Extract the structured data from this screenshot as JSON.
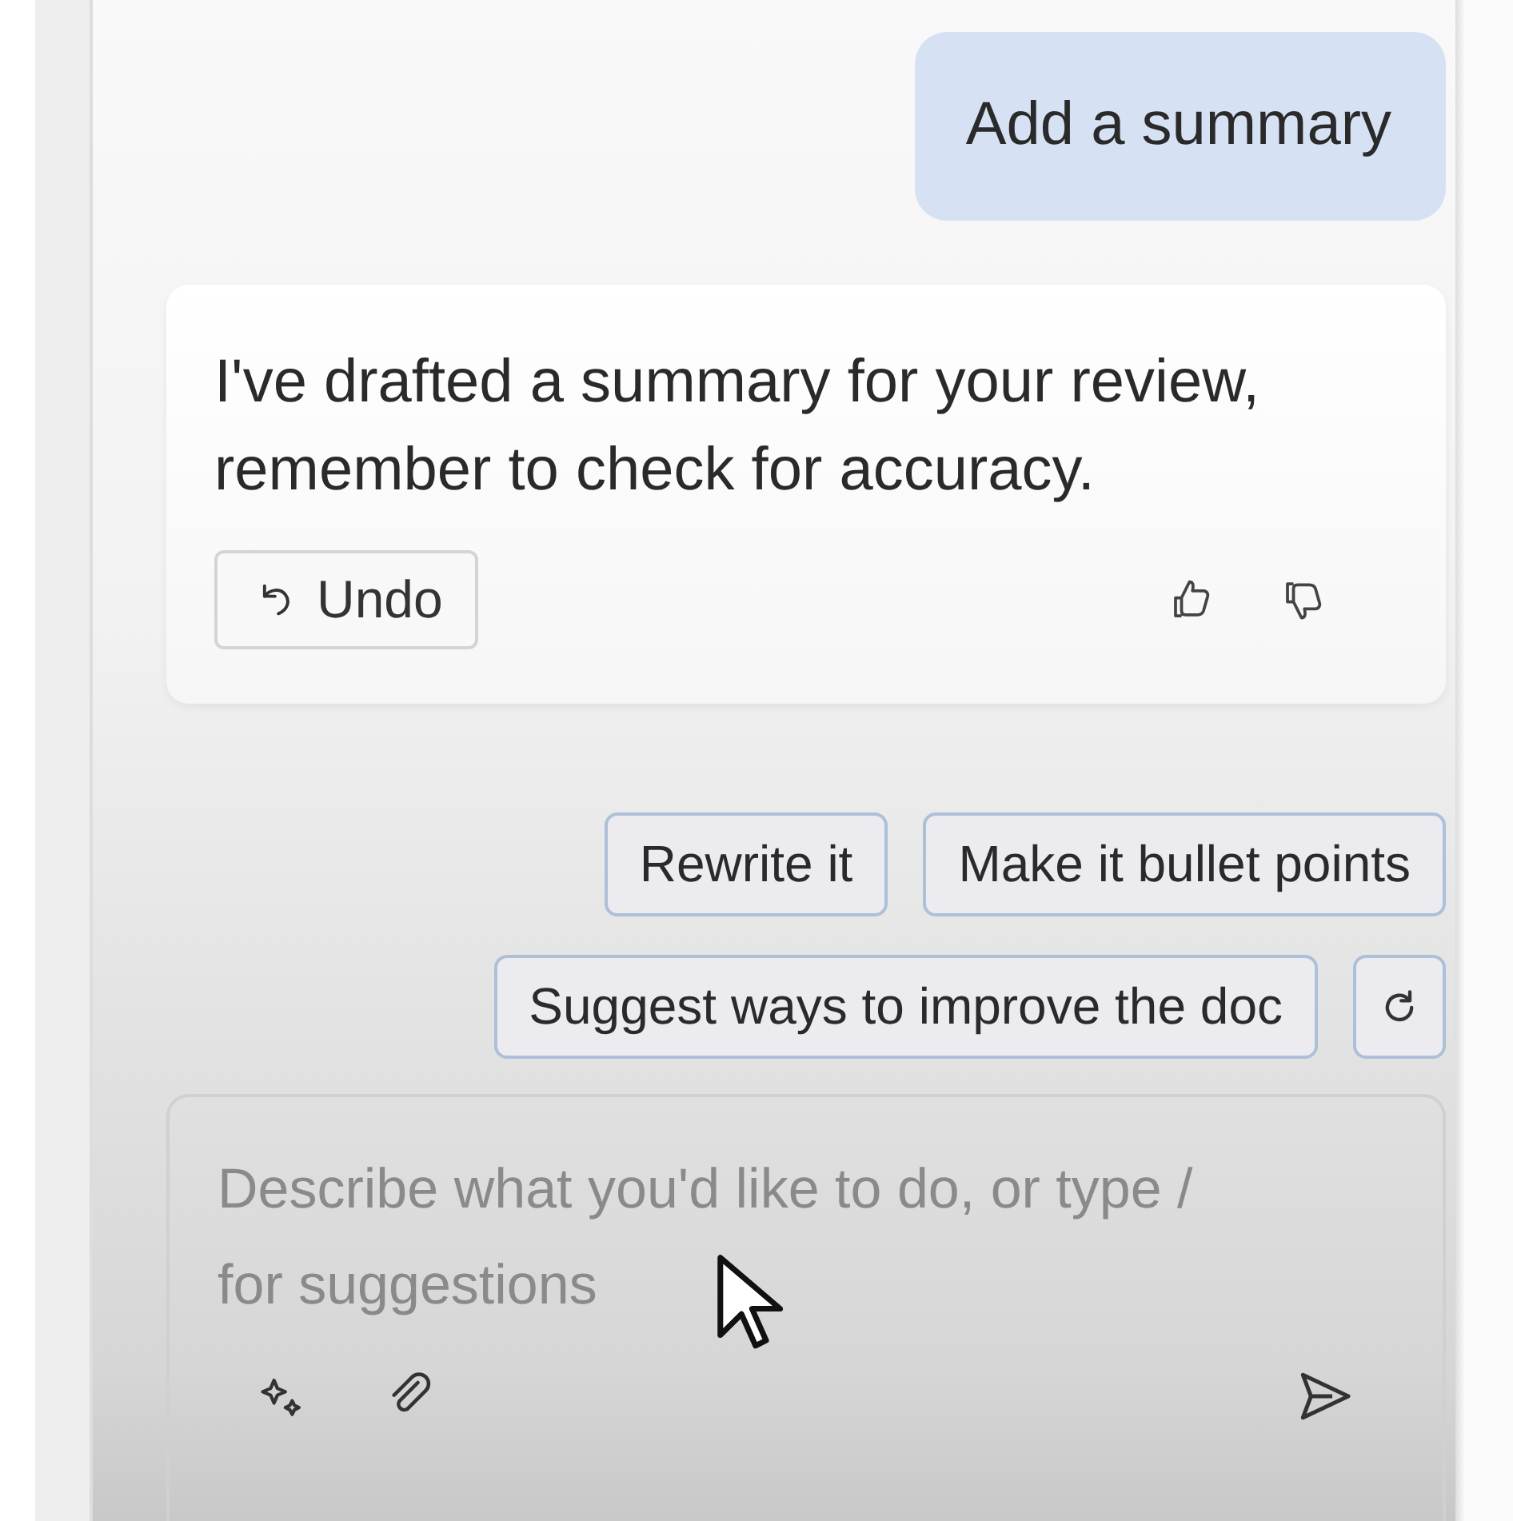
{
  "user_message": {
    "text": "Add a summary"
  },
  "assistant_message": {
    "text": "I've drafted a summary for your review, remember to check for accuracy.",
    "undo_button": {
      "label": "Undo"
    }
  },
  "suggestion_rows": [
    [
      "Rewrite it",
      "Make it bullet points"
    ],
    [
      "Suggest ways to improve the doc"
    ]
  ],
  "composer": {
    "placeholder": "Describe what you'd like to do, or type / for suggestions"
  }
}
